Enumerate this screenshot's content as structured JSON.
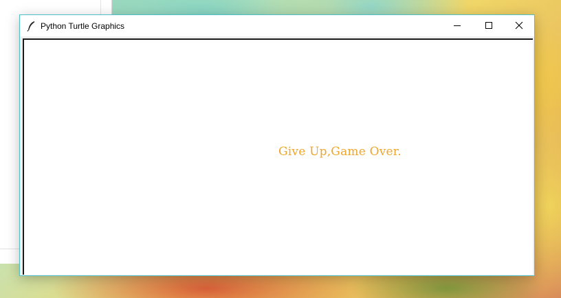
{
  "window": {
    "title": "Python Turtle Graphics",
    "app_icon": "feather-icon",
    "controls": {
      "minimize_icon": "minimize-icon",
      "maximize_icon": "maximize-icon",
      "close_icon": "close-icon"
    },
    "accent_color": "#4fbfc8"
  },
  "canvas": {
    "background": "#ffffff",
    "message": "Give Up,Game Over.",
    "message_color": "#f0a42a"
  }
}
